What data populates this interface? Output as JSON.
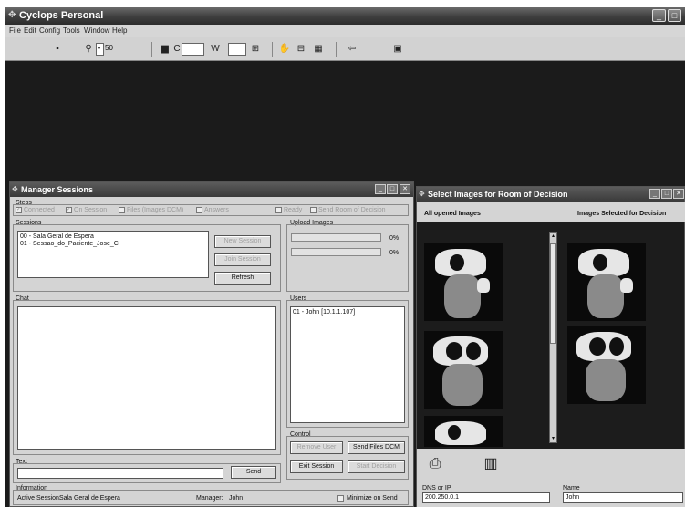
{
  "app": {
    "title": "Cyclops Personal",
    "menu": [
      "File",
      "Edit",
      "Config",
      "Tools",
      "Window",
      "Help"
    ],
    "toolbar": {
      "zoom_value": "50",
      "c_label": "C",
      "w_label": "W"
    }
  },
  "manager": {
    "title": "Manager Sessions",
    "steps_label": "Steps",
    "steps": [
      "Connected",
      "On Session",
      "Files (Images DCM)",
      "Answers",
      "Ready",
      "Send Room of Decision"
    ],
    "sessions_label": "Sessions",
    "sessions": [
      "00 - Sala Geral de Espera",
      "01 - Sessao_do_Paciente_Jose_C"
    ],
    "new_session": "New Session",
    "join_session": "Join Session",
    "refresh": "Refresh",
    "upload_label": "Upload Images",
    "upload_pct_1": "0%",
    "upload_pct_2": "0%",
    "chat_label": "Chat",
    "users_label": "Users",
    "users": [
      "01 - John [10.1.1.107]"
    ],
    "control_label": "Control",
    "remove_user": "Remove User",
    "send_files": "Send Files DCM",
    "exit_session": "Exit Session",
    "start_decision": "Start Decision",
    "text_label": "Text",
    "send": "Send",
    "info_label": "Information",
    "active_session_label": "Active Session:",
    "active_session": "Sala Geral de Espera",
    "manager_label": "Manager:",
    "manager_name": "John",
    "minimize_on_send": "Minimize on Send"
  },
  "select": {
    "title": "Select Images for Room of Decision",
    "all_label": "All opened Images",
    "selected_label": "Images Selected for Decision",
    "dns_label": "DNS or IP",
    "dns_value": "200.250.0.1",
    "name_label": "Name",
    "name_value": "John"
  }
}
